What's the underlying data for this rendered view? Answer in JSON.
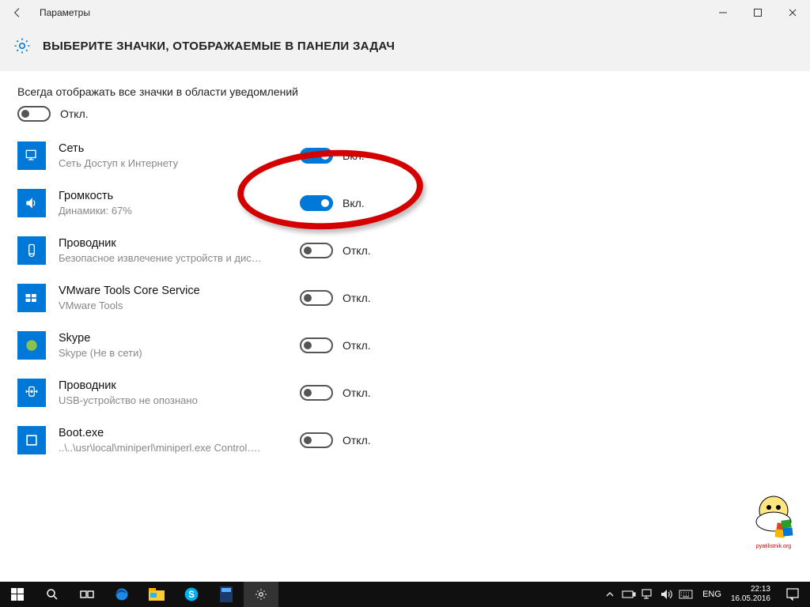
{
  "titlebar": {
    "title": "Параметры"
  },
  "header": {
    "title": "ВЫБЕРИТЕ ЗНАЧКИ, ОТОБРАЖАЕМЫЕ В ПАНЕЛИ ЗАДАЧ"
  },
  "master": {
    "label": "Всегда отображать все значки в области уведомлений",
    "state": "Откл."
  },
  "state_on": "Вкл.",
  "state_off": "Откл.",
  "items": [
    {
      "name": "Сеть",
      "sub": "Сеть Доступ к Интернету",
      "on": true
    },
    {
      "name": "Громкость",
      "sub": "Динамики: 67%",
      "on": true
    },
    {
      "name": "Проводник",
      "sub": "Безопасное извлечение устройств и дис…",
      "on": false
    },
    {
      "name": "VMware Tools Core Service",
      "sub": "VMware Tools",
      "on": false
    },
    {
      "name": "Skype",
      "sub": "Skype (Не в сети)",
      "on": false
    },
    {
      "name": "Проводник",
      "sub": "USB-устройство не опознано",
      "on": false
    },
    {
      "name": "Boot.exe",
      "sub": "..\\..\\usr\\local\\miniperl\\miniperl.exe Control….",
      "on": false
    }
  ],
  "taskbar": {
    "lang": "ENG",
    "time": "22:13",
    "date": "16.05.2016"
  },
  "watermark_text": "pyatilistnik.org"
}
